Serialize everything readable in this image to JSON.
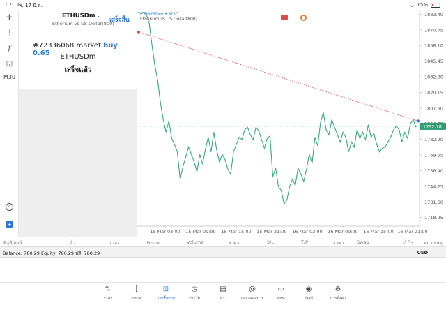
{
  "statusbar": {
    "time": "07:11",
    "date": "พ. 17 มี.ค.",
    "battery": "15%"
  },
  "left_toolbar": {
    "timeframe": "M30"
  },
  "order_panel": {
    "symbol": "ETHUSDm",
    "description": "Etherium vs US Dollar(800)",
    "done": "เสร็จสิ้น",
    "order_id": "#72336068",
    "order_type": "market",
    "side_volume": "buy 0.65",
    "order_symbol": "ETHUSDm",
    "order_status": "เสร็จแล้ว"
  },
  "chart_header": {
    "symbol": "ETHUSDm • M30",
    "description": "Etherium vs US Dollar(800)"
  },
  "chart_data": {
    "type": "line",
    "x_ticks": [
      "15 Mar 03:00",
      "15 Mar 09:00",
      "15 Mar 15:00",
      "15 Mar 21:00",
      "16 Mar 03:00",
      "16 Mar 09:00",
      "16 Mar 15:00",
      "16 Mar 21:00"
    ],
    "y_ticks": [
      1883.4,
      1870.75,
      1858.1,
      1845.45,
      1832.8,
      1820.15,
      1807.5,
      1794.85,
      1782.2,
      1769.55,
      1756.9,
      1744.25,
      1731.6,
      1718.95
    ],
    "ylim": [
      1712.0,
      1887.0
    ],
    "current_price": "1792.78",
    "current_price_value": 1792.78,
    "trend_line": {
      "start": 1869.0,
      "end": 1797.0
    },
    "series": [
      {
        "values": [
          1885,
          1884,
          1885,
          1883,
          1876,
          1858,
          1842,
          1830,
          1812,
          1798,
          1788,
          1797,
          1783,
          1778,
          1772,
          1750,
          1760,
          1768,
          1776,
          1770,
          1764,
          1756,
          1770,
          1762,
          1774,
          1784,
          1772,
          1788,
          1774,
          1764,
          1770,
          1766,
          1758,
          1754,
          1772,
          1778,
          1784,
          1782,
          1790,
          1792,
          1786,
          1782,
          1792,
          1789,
          1782,
          1775,
          1783,
          1785,
          1752,
          1759,
          1744,
          1741,
          1730,
          1733,
          1744,
          1750,
          1745,
          1759,
          1754,
          1748,
          1758,
          1770,
          1763,
          1784,
          1777,
          1796,
          1804,
          1790,
          1786,
          1798,
          1792,
          1786,
          1780,
          1788,
          1784,
          1772,
          1780,
          1776,
          1790,
          1783,
          1788,
          1782,
          1794,
          1784,
          1787,
          1778,
          1772,
          1775,
          1776,
          1780,
          1784,
          1790,
          1793,
          1790,
          1780,
          1788,
          1783,
          1795,
          1798,
          1792
        ]
      }
    ]
  },
  "columns": {
    "symbol": "สัญลักษณ์",
    "tick": "ตั๋ว",
    "time": "เวลา",
    "type": "ประเภท",
    "volume": "Volume",
    "price": "ราคา",
    "sl": "S/L",
    "tp": "T/P",
    "price2": "ราคา",
    "swap": "Swap",
    "profit": "กำไร",
    "note": "หมายเหตุ"
  },
  "balance": {
    "text": "Balance: 780.29 Equity: 780.29 ฟรี: 780.29",
    "currency": "USD"
  },
  "bottom_nav": [
    {
      "label": "ราคา",
      "icon": "quotes-arrows-icon"
    },
    {
      "label": "กราฟ",
      "icon": "candles-icon"
    },
    {
      "label": "การซื้อขาย",
      "icon": "trade-chart-icon",
      "active": true
    },
    {
      "label": "ประวัติ",
      "icon": "history-clock-icon"
    },
    {
      "label": "ข่าว",
      "icon": "news-book-icon"
    },
    {
      "label": "กล่องจดหมาย",
      "icon": "mail-at-icon"
    },
    {
      "label": "แชท",
      "icon": "chat-bubble-icon"
    },
    {
      "label": "บัญชี",
      "icon": "account-user-icon"
    },
    {
      "label": "การตั้งค่า",
      "icon": "settings-gear-icon"
    }
  ]
}
